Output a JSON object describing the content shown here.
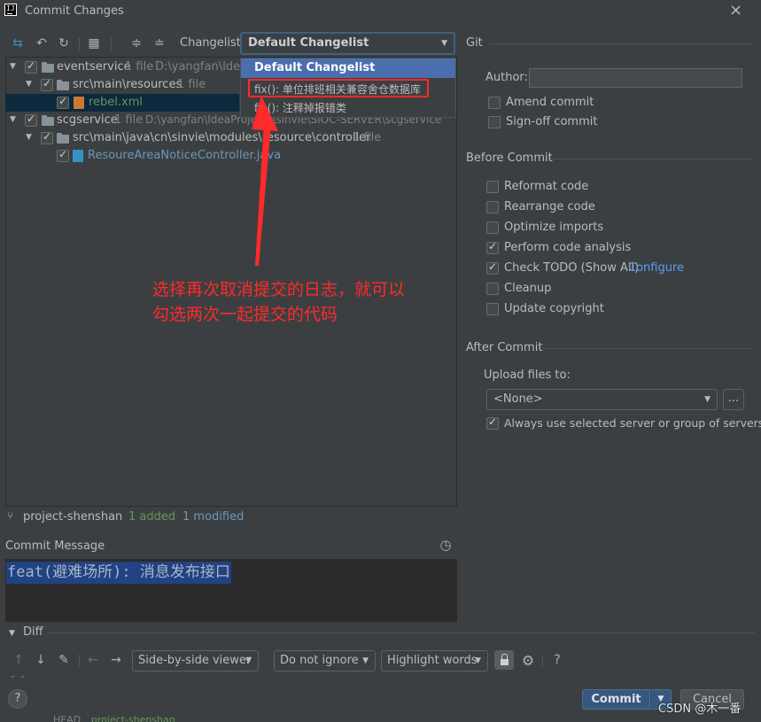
{
  "window": {
    "title": "Commit Changes",
    "app_icon": "IJ"
  },
  "toolbar": {
    "changelist_label": "Changelist:",
    "changelist_value": "Default Changelist"
  },
  "dropdown": {
    "items": [
      {
        "label": "Default Changelist"
      },
      {
        "label": "fix(): 单位排班相关兼容舍仓数据库"
      },
      {
        "label": "fix(): 注释掉报错类"
      }
    ]
  },
  "tree": {
    "nodes": [
      {
        "name": "eventservice",
        "count": "1 file",
        "path": "D:\\yangfan\\Idea"
      },
      {
        "name": "src\\main\\resources",
        "count": "1 file"
      },
      {
        "name": "rebel.xml"
      },
      {
        "name": "scgservice",
        "count": "1 file",
        "path": "D:\\yangfan\\IdeaProjects\\sinvie\\SIOC-SERVER\\scgservice"
      },
      {
        "name": "src\\main\\java\\cn\\sinvie\\modules\\resource\\controller",
        "count": "1 file"
      },
      {
        "name": "ResoureAreaNoticeController.java"
      }
    ]
  },
  "annotation": {
    "line1": "选择再次取消提交的日志，就可以",
    "line2": "勾选两次一起提交的代码"
  },
  "status": {
    "project": "project-shenshan",
    "added": "1 added",
    "modified": "1 modified"
  },
  "commit_message": {
    "label": "Commit Message",
    "text": "feat(避难场所): 消息发布接口"
  },
  "right": {
    "git_title": "Git",
    "author_label": "Author:",
    "author_value": "",
    "amend": "Amend commit",
    "signoff": "Sign-off commit",
    "before_title": "Before Commit",
    "reformat": "Reformat code",
    "rearrange": "Rearrange code",
    "optimize": "Optimize imports",
    "analysis": "Perform code analysis",
    "todo": "Check TODO (Show All)",
    "configure": "Configure",
    "cleanup": "Cleanup",
    "copyright": "Update copyright",
    "after_title": "After Commit",
    "upload_label": "Upload files to:",
    "upload_value": "<None>",
    "browse": "...",
    "always_use": "Always use selected server or group of servers"
  },
  "diff": {
    "title": "Diff",
    "viewer": "Side-by-side viewer",
    "ignore": "Do not ignore",
    "highlight": "Highlight words"
  },
  "bottom": {
    "help": "?",
    "commit": "Commit",
    "cancel": "Cancel",
    "branch_left": "HEAD",
    "branch_right": "project-shenshan",
    "watermark": "CSDN @木一番"
  },
  "colors": {
    "background": "#3c3f41",
    "selection": "#4b6eaf",
    "annotation_red": "#ff2a2a",
    "added_green": "#629755",
    "modified_blue": "#6897bb",
    "link": "#589df6"
  }
}
